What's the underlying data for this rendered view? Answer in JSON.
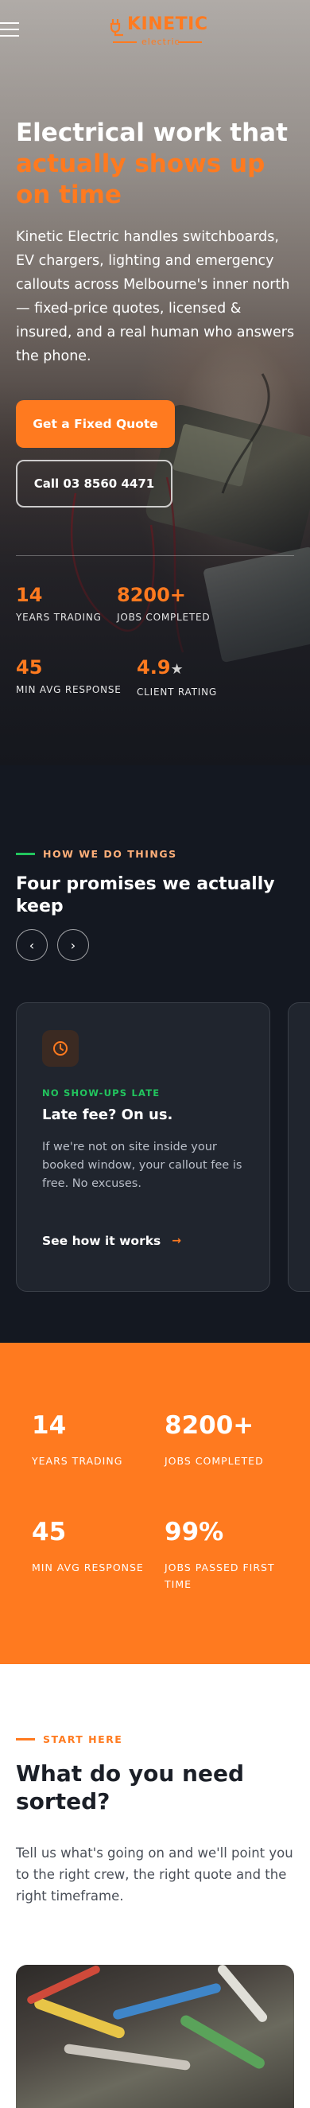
{
  "header": {
    "brand_name": "KINETIC",
    "brand_sub": "electric"
  },
  "hero": {
    "title_line1": "Electrical work that",
    "title_accent": "actually shows up on time",
    "lead": "Kinetic Electric handles switchboards, EV chargers, lighting and emergency callouts across Melbourne's inner north — fixed-price quotes, licensed & insured, and a real human who answers the phone.",
    "cta_primary": "Get a Fixed Quote",
    "cta_secondary": "Call 03 8560 4471",
    "stats": [
      {
        "value": "14",
        "label": "YEARS TRADING"
      },
      {
        "value": "8200+",
        "label": "JOBS COMPLETED"
      },
      {
        "value": "45",
        "label": "MIN AVG RESPONSE"
      },
      {
        "value": "4.9",
        "star": "★",
        "label": "CLIENT RATING"
      }
    ]
  },
  "promises": {
    "kicker": "HOW WE DO THINGS",
    "title": "Four promises we actually keep",
    "prev_icon": "‹",
    "next_icon": "›",
    "card": {
      "icon": "clock-icon",
      "tag": "NO SHOW-UPS LATE",
      "title": "Late fee? On us.",
      "text": "If we're not on site inside your booked window, your callout fee is free. No excuses.",
      "link": "See how it works",
      "link_arrow": "→"
    }
  },
  "stats_band": {
    "items": [
      {
        "value": "14",
        "label": "YEARS TRADING"
      },
      {
        "value": "8200+",
        "label": "JOBS COMPLETED"
      },
      {
        "value": "45",
        "label": "MIN AVG RESPONSE"
      },
      {
        "value": "99%",
        "label": "JOBS PASSED FIRST TIME"
      }
    ]
  },
  "start_here": {
    "kicker": "START HERE",
    "title": "What do you need sorted?",
    "text": "Tell us what's going on and we'll point you to the right crew, the right quote and the right timeframe."
  },
  "colors": {
    "accent": "#ff7a1f",
    "dark": "#141821",
    "green": "#22c55e"
  }
}
